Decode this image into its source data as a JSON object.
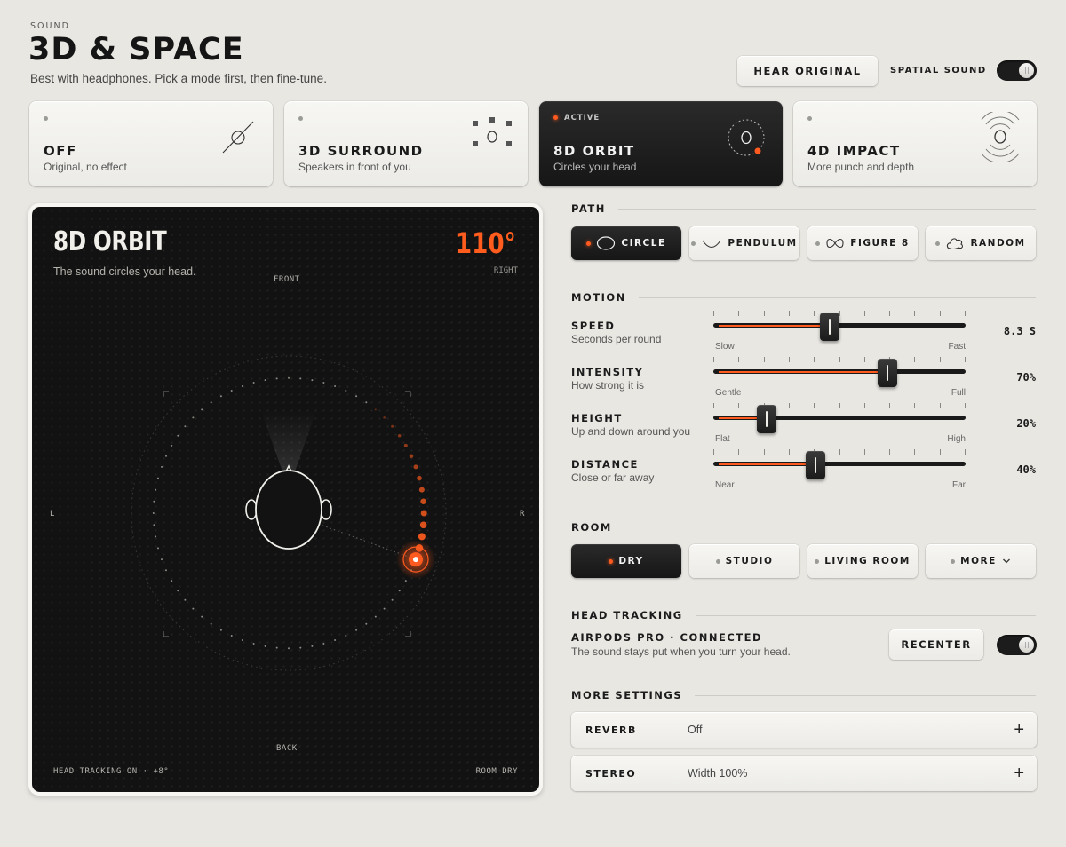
{
  "header": {
    "eyebrow": "SOUND",
    "title": "3D & SPACE",
    "subtitle": "Best with headphones. Pick a mode first, then fine-tune.",
    "hear_original": "HEAR ORIGINAL",
    "spatial_label": "SPATIAL SOUND",
    "spatial_on": true
  },
  "modes": [
    {
      "name": "OFF",
      "desc": "Original, no effect",
      "icon": "slash-circle-icon",
      "active": false
    },
    {
      "name": "3D SURROUND",
      "desc": "Speakers in front of you",
      "icon": "speakers-icon",
      "active": false
    },
    {
      "name": "8D ORBIT",
      "desc": "Circles your head",
      "icon": "orbit-icon",
      "active": true,
      "active_label": "ACTIVE"
    },
    {
      "name": "4D IMPACT",
      "desc": "More punch and depth",
      "icon": "impact-waves-icon",
      "active": false
    }
  ],
  "visualizer": {
    "title": "8D ORBIT",
    "subtitle": "The sound circles your head.",
    "degrees": "110°",
    "degrees_label": "RIGHT",
    "front": "FRONT",
    "back": "BACK",
    "left": "L",
    "right": "R",
    "footer_left": "HEAD TRACKING ON · +8°",
    "footer_right": "ROOM DRY",
    "angle_deg": 110,
    "accent": "#ff5c1e"
  },
  "path": {
    "heading": "PATH",
    "options": [
      {
        "label": "CIRCLE",
        "icon": "circle-path-icon",
        "active": true
      },
      {
        "label": "PENDULUM",
        "icon": "pendulum-path-icon",
        "active": false
      },
      {
        "label": "FIGURE 8",
        "icon": "figure8-path-icon",
        "active": false
      },
      {
        "label": "RANDOM",
        "icon": "random-path-icon",
        "active": false
      }
    ]
  },
  "motion": {
    "heading": "MOTION",
    "sliders": [
      {
        "label": "SPEED",
        "sub": "Seconds per round",
        "value": "8.3 S",
        "min": "Slow",
        "max": "Fast",
        "level": 0.46
      },
      {
        "label": "INTENSITY",
        "sub": "How strong it is",
        "value": "70%",
        "min": "Gentle",
        "max": "Full",
        "level": 0.7
      },
      {
        "label": "HEIGHT",
        "sub": "Up and down around you",
        "value": "20%",
        "min": "Flat",
        "max": "High",
        "level": 0.2
      },
      {
        "label": "DISTANCE",
        "sub": "Close or far away",
        "value": "40%",
        "min": "Near",
        "max": "Far",
        "level": 0.4
      }
    ]
  },
  "room": {
    "heading": "ROOM",
    "options": [
      {
        "label": "DRY",
        "active": true
      },
      {
        "label": "STUDIO",
        "active": false
      },
      {
        "label": "LIVING ROOM",
        "active": false
      },
      {
        "label": "MORE",
        "active": false,
        "icon": "chevron-down-icon"
      }
    ]
  },
  "head_tracking": {
    "heading": "HEAD TRACKING",
    "device": "AIRPODS PRO · CONNECTED",
    "desc": "The sound stays put when you turn your head.",
    "recenter": "RECENTER",
    "on": true
  },
  "more_settings": {
    "heading": "MORE SETTINGS",
    "rows": [
      {
        "key": "REVERB",
        "value": "Off"
      },
      {
        "key": "STEREO",
        "value": "Width 100%"
      }
    ]
  }
}
